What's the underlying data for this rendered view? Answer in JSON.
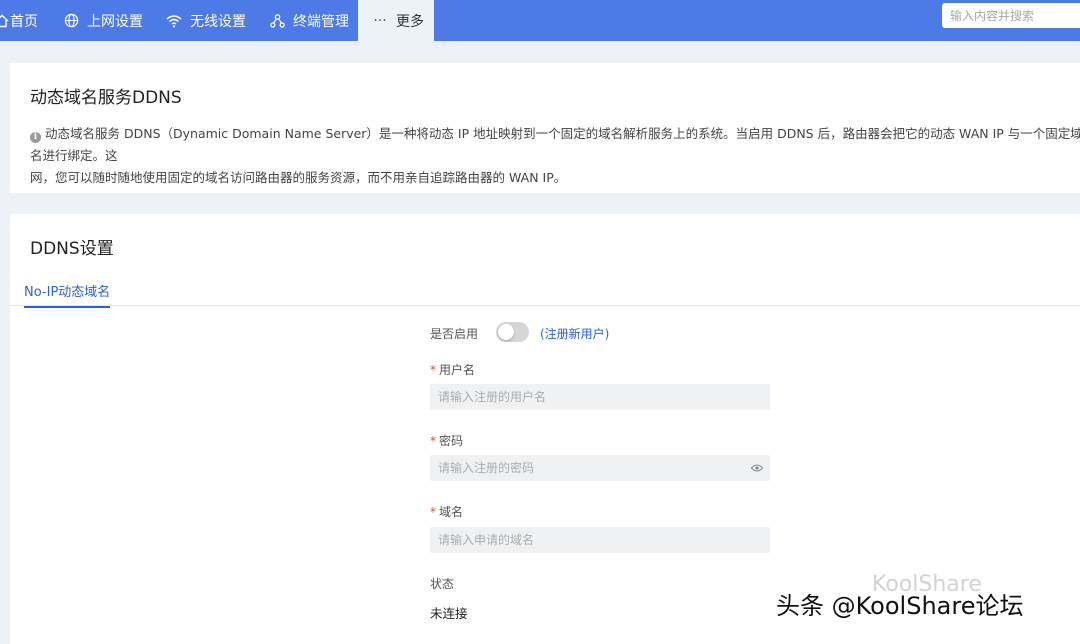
{
  "nav": {
    "items": [
      {
        "label": "首页",
        "icon": "home-icon"
      },
      {
        "label": "上网设置",
        "icon": "globe-icon"
      },
      {
        "label": "无线设置",
        "icon": "wifi-icon"
      },
      {
        "label": "终端管理",
        "icon": "devices-icon"
      },
      {
        "label": "更多",
        "icon": "more-icon"
      }
    ],
    "active": "更多",
    "search_placeholder": "输入内容并搜索"
  },
  "ddns_info": {
    "title": "动态域名服务DDNS",
    "line1": "动态域名服务 DDNS（Dynamic Domain Name Server）是一种将动态 IP 地址映射到一个固定的域名解析服务上的系统。当启用 DDNS 后，路由器会把它的动态 WAN IP 与一个固定域名进行绑定。这",
    "line2": "网，您可以随时随地使用固定的域名访问路由器的服务资源，而不用亲自追踪路由器的 WAN IP。"
  },
  "ddns_settings": {
    "title": "DDNS设置",
    "tab_label": "No-IP动态域名",
    "enable_label": "是否启用",
    "enabled": false,
    "register_link": "(注册新用户)",
    "username": {
      "label": "用户名",
      "placeholder": "请输入注册的用户名",
      "value": ""
    },
    "password": {
      "label": "密码",
      "placeholder": "请输入注册的密码",
      "value": ""
    },
    "domain": {
      "label": "域名",
      "placeholder": "请输入申请的域名",
      "value": ""
    },
    "status_label": "状态",
    "status_value": "未连接"
  },
  "watermark": {
    "text": "头条 @KoolShare论坛",
    "faint": "KoolShare"
  },
  "colors": {
    "nav_bg": "#4d7ae6",
    "accent": "#2f5fd6",
    "required": "#e0473e"
  }
}
